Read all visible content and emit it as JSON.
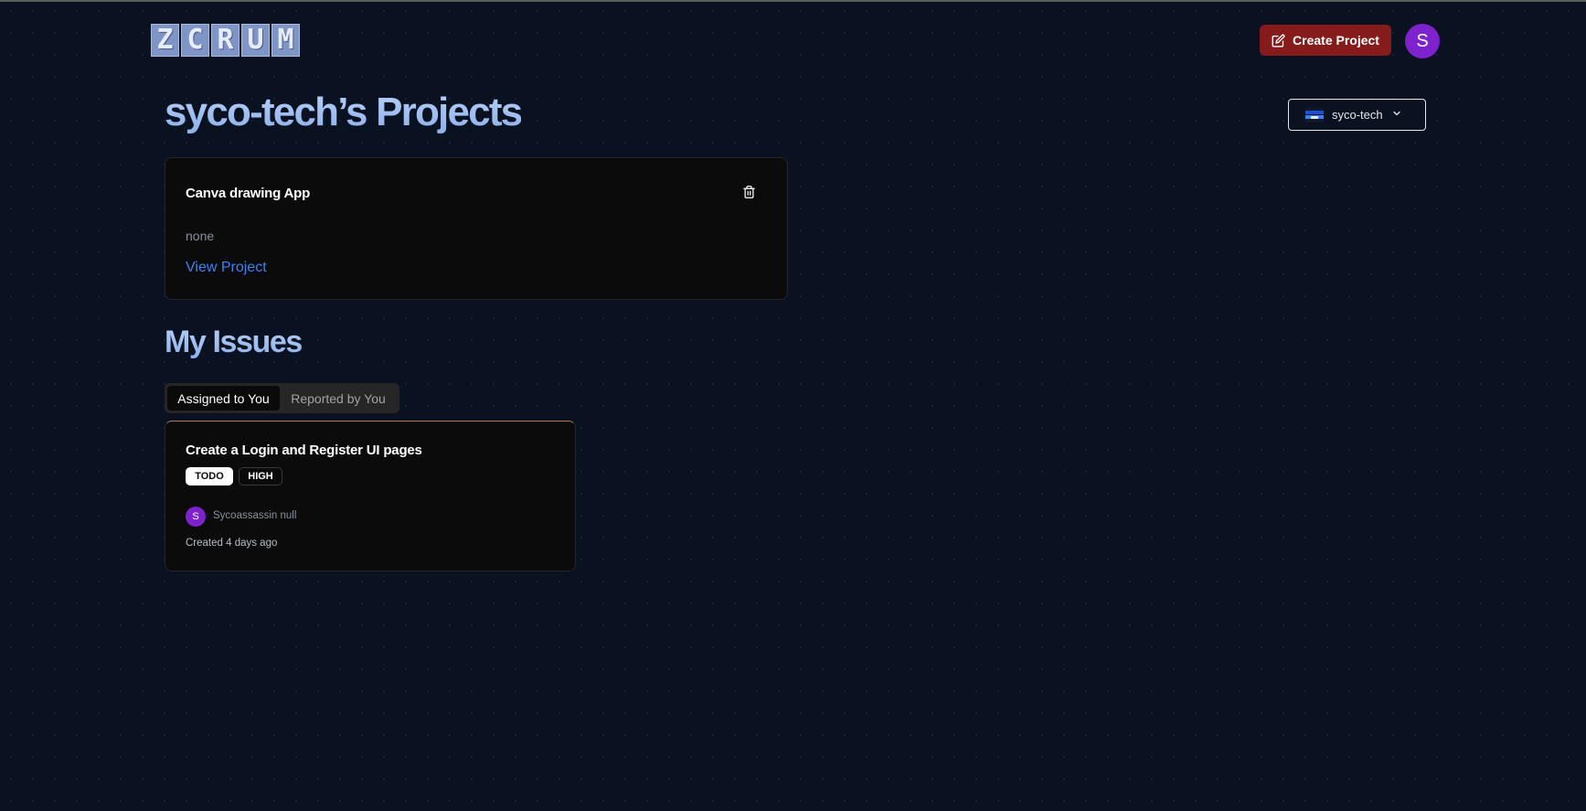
{
  "header": {
    "logo_letters": [
      "Z",
      "C",
      "R",
      "U",
      "M"
    ],
    "create_project_label": "Create Project",
    "user_initial": "S"
  },
  "main": {
    "title": "syco-tech’s Projects",
    "org_switcher": {
      "label": "syco-tech"
    }
  },
  "projects": [
    {
      "name": "Canva drawing App",
      "description": "none",
      "link_label": "View Project"
    }
  ],
  "issues_section": {
    "title": "My Issues",
    "tabs": [
      {
        "label": "Assigned to You",
        "active": true
      },
      {
        "label": "Reported by You",
        "active": false
      }
    ],
    "issues": [
      {
        "title": "Create a Login and Register UI pages",
        "status": "TODO",
        "priority": "HIGH",
        "assignee_initial": "S",
        "assignee_name": "Sycoassassin null",
        "created": "Created 4 days ago"
      }
    ]
  },
  "colors": {
    "background": "#0a1120",
    "accent_gradient_title": "#9fc0f2",
    "create_button": "#861b1b",
    "avatar": "#7e22ce",
    "link": "#3b82f6",
    "priority_high_border": "#b7794a"
  },
  "icons": {
    "create_button_icon": "edit-icon",
    "delete_project_icon": "trash-icon",
    "org_dropdown_icon": "chevron-down-icon"
  }
}
